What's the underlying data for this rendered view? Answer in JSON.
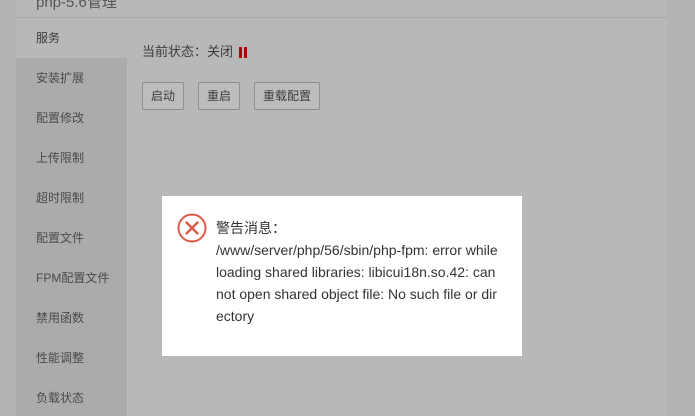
{
  "panel": {
    "title": "php-5.6管理"
  },
  "sidebar": {
    "items": [
      {
        "label": "服务"
      },
      {
        "label": "安装扩展"
      },
      {
        "label": "配置修改"
      },
      {
        "label": "上传限制"
      },
      {
        "label": "超时限制"
      },
      {
        "label": "配置文件"
      },
      {
        "label": "FPM配置文件"
      },
      {
        "label": "禁用函数"
      },
      {
        "label": "性能调整"
      },
      {
        "label": "负载状态"
      }
    ]
  },
  "service": {
    "status_label": "当前状态：关闭",
    "status_color": "#b30000",
    "buttons": {
      "start": "启动",
      "restart": "重启",
      "reload": "重载配置"
    }
  },
  "dialog": {
    "heading": "警告消息：",
    "message": "/www/server/php/56/sbin/php-fpm: error while loading shared libraries: libicui18n.so.42: cannot open shared object file: No such file or directory",
    "icon_color": "#e05a4a"
  }
}
